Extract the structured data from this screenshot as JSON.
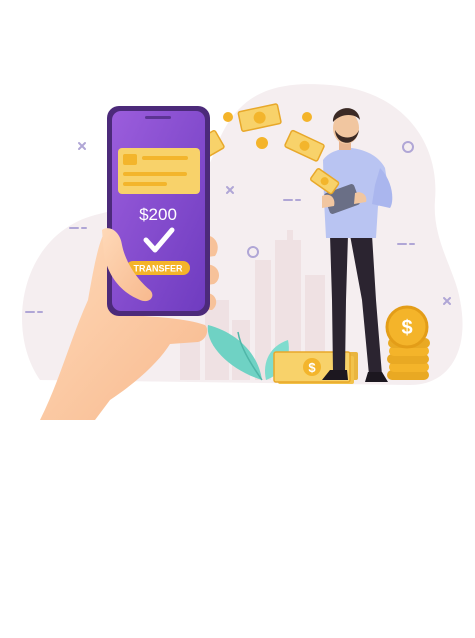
{
  "phone": {
    "amount": "$200",
    "button_label": "TRANSFER"
  },
  "colors": {
    "phone_purple": "#8b4fd0",
    "coin_gold": "#f4b42a",
    "bill_yellow": "#f8d26a",
    "leaf_teal": "#6fd2c4",
    "shirt_lavender": "#b9c4f2",
    "background_blob": "#f5eef0"
  },
  "icons": [
    "check-icon",
    "card-icon",
    "dollar-coin-icon",
    "dollar-bill-icon",
    "cross-sparkle-icon",
    "ring-sparkle-icon"
  ]
}
